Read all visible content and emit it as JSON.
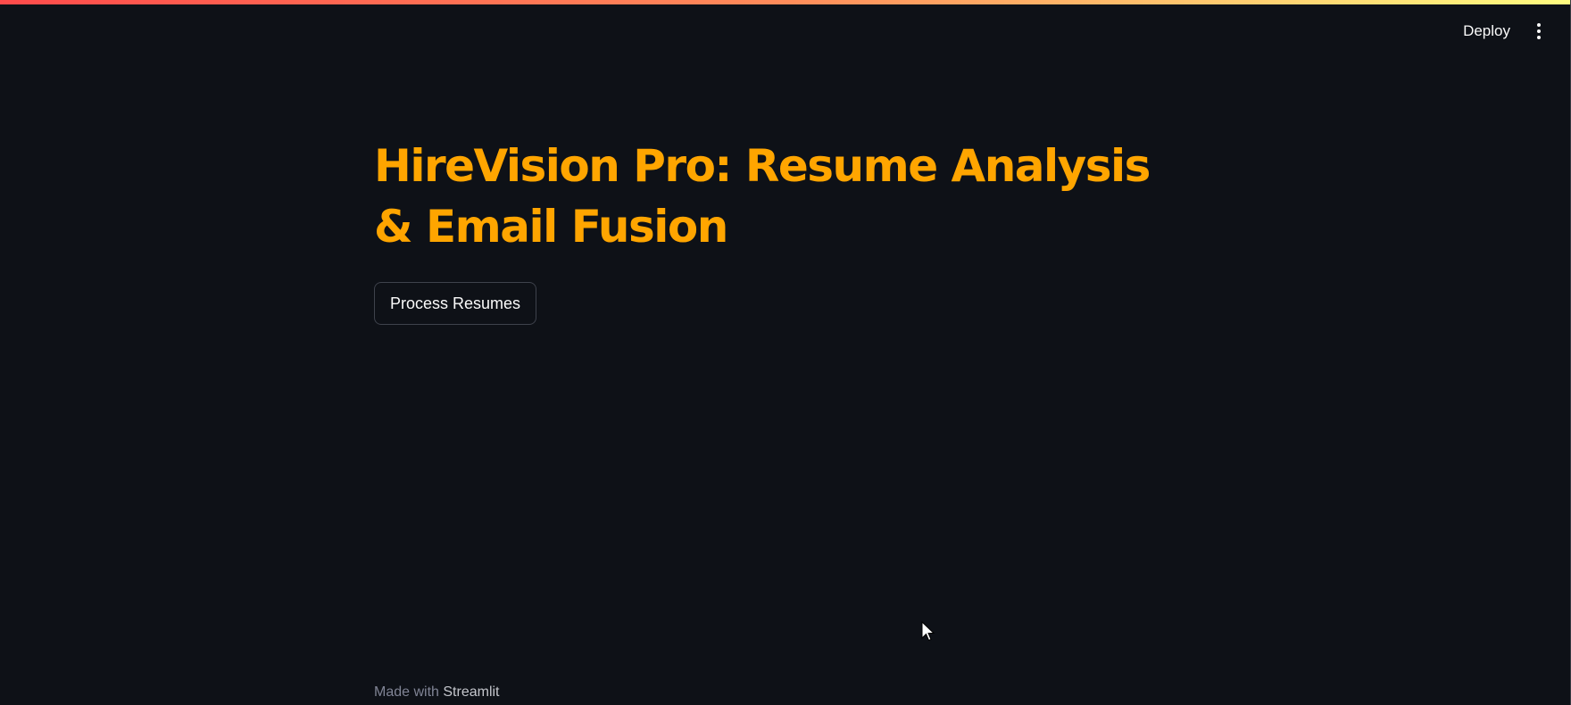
{
  "header": {
    "deploy_label": "Deploy",
    "menu_icon": "kebab-menu-icon"
  },
  "main": {
    "title": "HireVision Pro: Resume Analysis & Email Fusion",
    "process_button_label": "Process Resumes"
  },
  "footer": {
    "prefix": "Made with",
    "brand": "Streamlit"
  },
  "colors": {
    "background": "#0e1117",
    "title": "#ffa500",
    "text": "#fafafa",
    "muted": "#808495",
    "button_border": "#3e424c"
  }
}
